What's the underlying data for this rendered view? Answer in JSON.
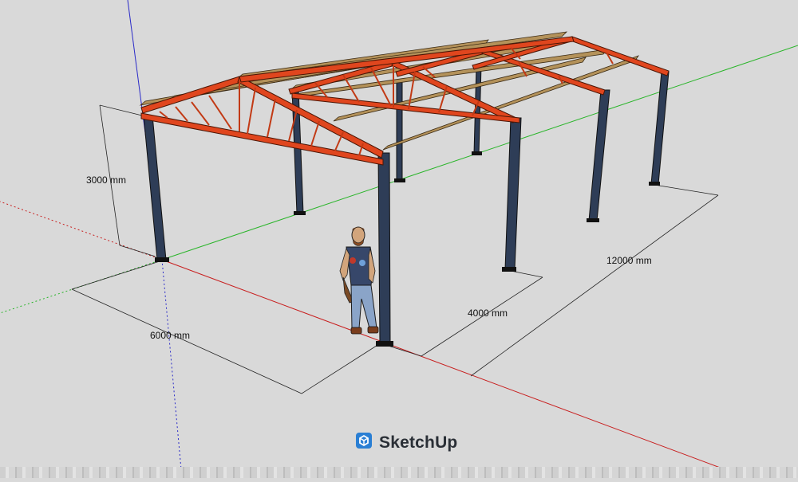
{
  "app": {
    "name": "SketchUp"
  },
  "dimensions": {
    "height": "3000 mm",
    "width": "6000 mm",
    "bay": "4000 mm",
    "length": "12000 mm"
  },
  "colors": {
    "background": "#d9d9d9",
    "rafter": "#e0461e",
    "purlin": "#b4925a",
    "column": "#2e3d57",
    "axis_red": "#c81e1e",
    "axis_green": "#2ab52a",
    "axis_blue": "#2b2bc8",
    "logo": "#2a7fd4"
  },
  "icons": {
    "logo": "sketchup-logo-icon"
  }
}
